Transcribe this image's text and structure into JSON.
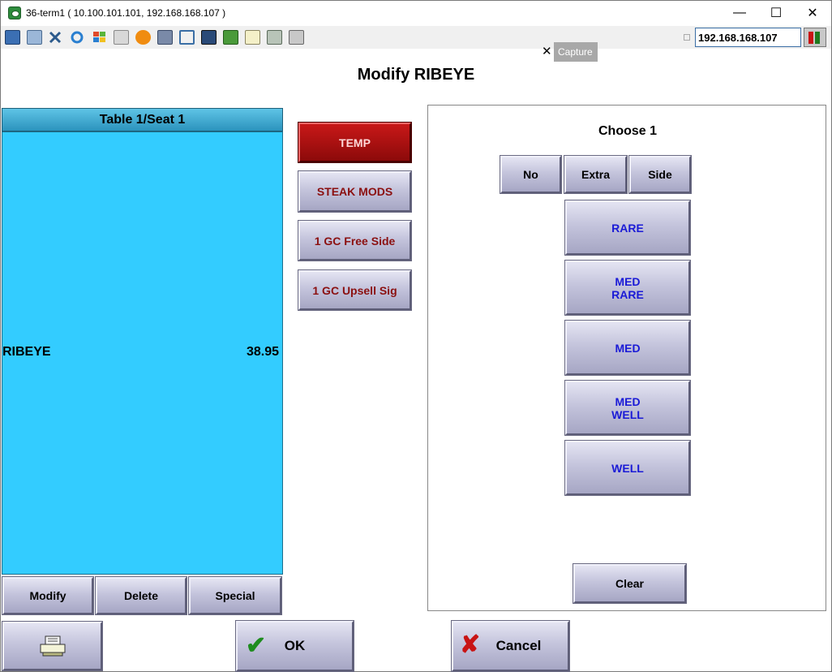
{
  "window": {
    "title": "36-term1 ( 10.100.101.101, 192.168.168.107 )",
    "controls": {
      "minimize": "—",
      "maximize": "☐",
      "close": "✕"
    }
  },
  "toolbar": {
    "icons": [
      "monitor-icon",
      "windows-icon",
      "tools-icon",
      "refresh-icon",
      "windows-flag-icon",
      "keyboard-icon",
      "alert-icon",
      "network-icon",
      "fullscreen-icon",
      "display-icon",
      "transfer-icon",
      "notepad-icon",
      "resize-icon",
      "chat-icon"
    ],
    "ip_address": "192.168.168.107",
    "capture_tooltip": "Capture"
  },
  "page": {
    "title": "Modify RIBEYE"
  },
  "check": {
    "header": "Table 1/Seat 1",
    "items": [
      {
        "name": "RIBEYE",
        "price": "38.95"
      }
    ],
    "bg_color": "#33ccff"
  },
  "check_actions": {
    "modify": "Modify",
    "delete": "Delete",
    "special": "Special"
  },
  "modifier_groups": [
    {
      "label": "TEMP",
      "active": true
    },
    {
      "label": "STEAK MODS",
      "active": false
    },
    {
      "label": "1 GC Free Side",
      "active": false
    },
    {
      "label": "1 GC Upsell Sig",
      "active": false
    }
  ],
  "choose_panel": {
    "title": "Choose 1",
    "qualifiers": [
      "No",
      "Extra",
      "Side"
    ],
    "options": [
      {
        "line1": "RARE",
        "line2": ""
      },
      {
        "line1": "MED",
        "line2": "RARE"
      },
      {
        "line1": "MED",
        "line2": ""
      },
      {
        "line1": "MED",
        "line2": "WELL"
      },
      {
        "line1": "WELL",
        "line2": ""
      }
    ],
    "clear": "Clear"
  },
  "footer": {
    "ok": "OK",
    "cancel": "Cancel"
  },
  "colors": {
    "accent_red": "#8b1010",
    "option_blue": "#1a1ad6",
    "check_blue": "#33ccff"
  }
}
